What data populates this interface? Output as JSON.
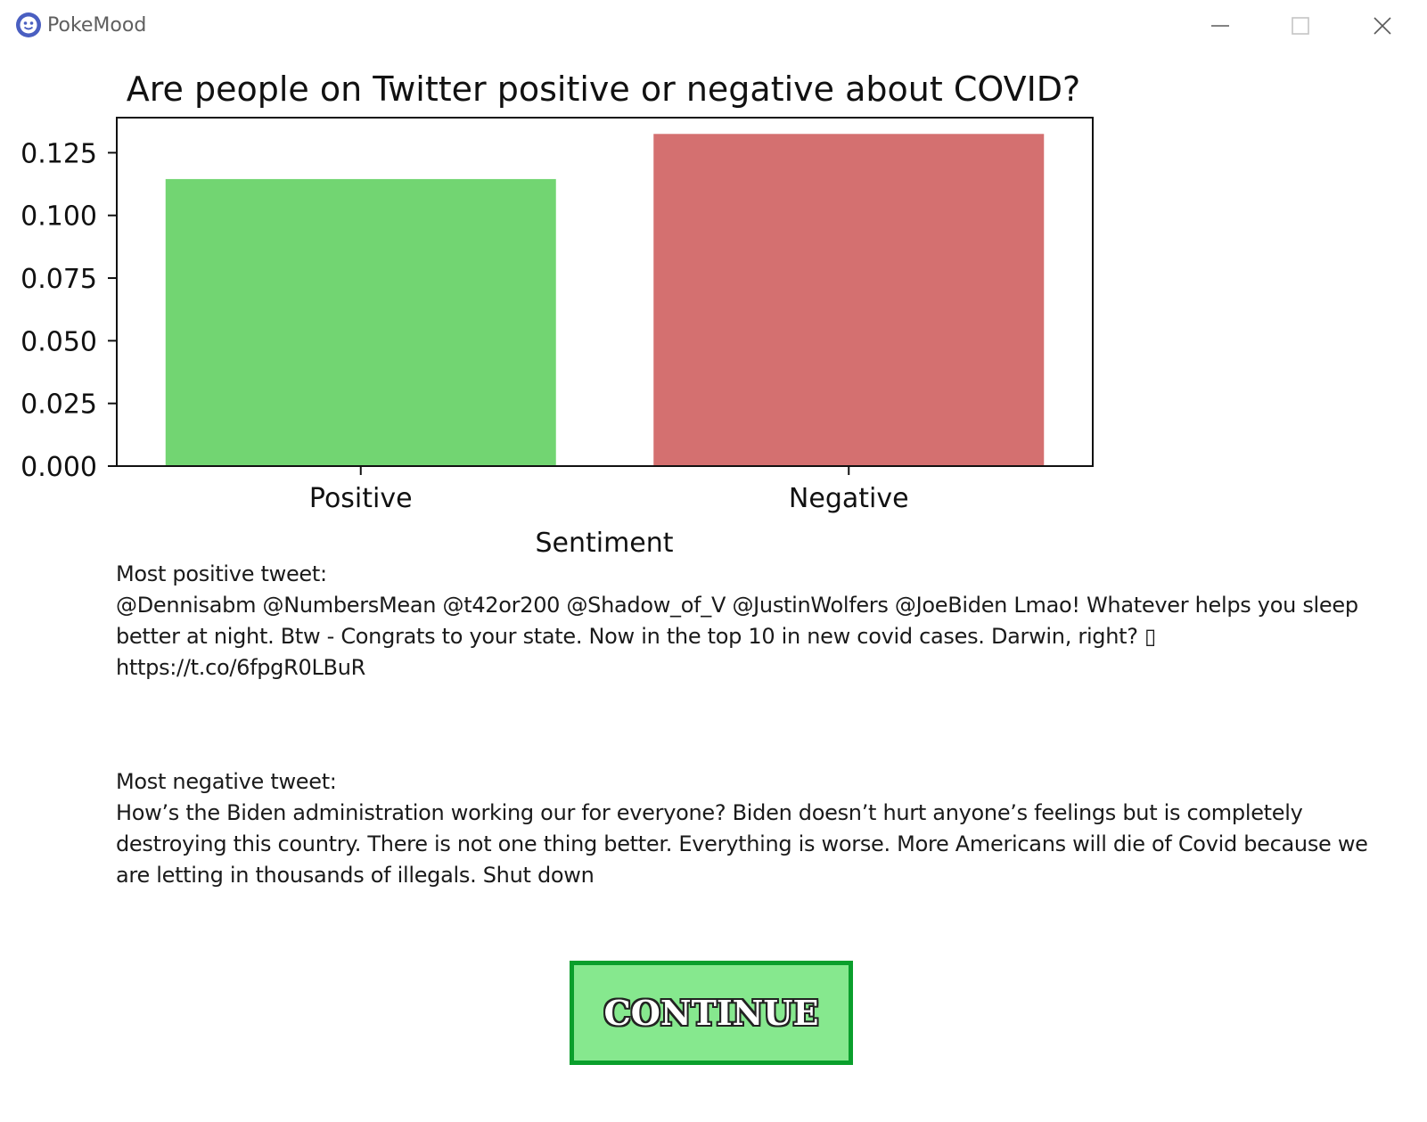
{
  "window": {
    "app_title": "PokeMood",
    "app_icon": "pokemood-logo-icon",
    "controls": [
      "minimize-icon",
      "maximize-icon",
      "close-icon"
    ]
  },
  "chart_data": {
    "type": "bar",
    "title": "Are people on Twitter positive or negative about COVID?",
    "xlabel": "Sentiment",
    "ylabel": "",
    "categories": [
      "Positive",
      "Negative"
    ],
    "values": [
      0.1145,
      0.1325
    ],
    "colors": [
      "#72d572",
      "#d47070"
    ],
    "ylim": [
      0,
      0.139
    ],
    "yticks": [
      "0.000",
      "0.025",
      "0.050",
      "0.075",
      "0.100",
      "0.125"
    ],
    "ytick_values": [
      0,
      0.025,
      0.05,
      0.075,
      0.1,
      0.125
    ],
    "grid": false
  },
  "tweets": {
    "positive_label": "Most positive tweet:",
    "positive_text": "@Dennisabm @NumbersMean @t42or200 @Shadow_of_V @JustinWolfers @JoeBiden Lmao! Whatever helps you sleep better at night.   Btw - Congrats to your state. Now in the top 10 in new covid cases. Darwin, right? ▯ https://t.co/6fpgR0LBuR",
    "negative_label": "Most negative tweet:",
    "negative_text": "How’s the Biden administration working our for everyone? Biden doesn’t hurt anyone’s feelings but is completely destroying this country. There is not one thing better. Everything is worse. More Americans will die of Covid because we are letting in thousands of illegals. Shut down"
  },
  "continue_button": {
    "label": "CONTINUE",
    "fill": "#86e88e",
    "border": "#0a9f2c"
  }
}
